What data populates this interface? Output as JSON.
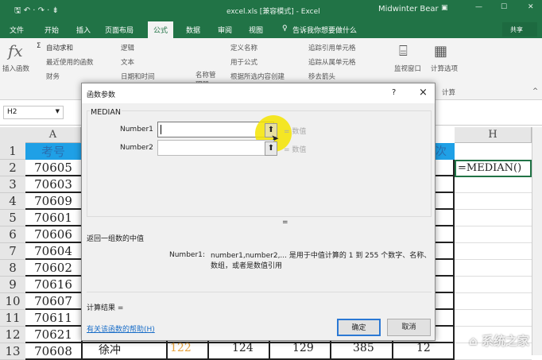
{
  "titlebar": {
    "title": "excel.xls [兼容模式] - Excel",
    "user": "Midwinter Bear"
  },
  "tabs": [
    "文件",
    "开始",
    "插入",
    "页面布局",
    "公式",
    "数据",
    "审阅",
    "视图"
  ],
  "tell_me": "告诉我你想要做什么",
  "share": "共享",
  "ribbon": {
    "insert_function": "插入函数",
    "autosum": "自动求和",
    "recent": "最近使用的函数",
    "financial": "财务",
    "logical": "逻辑",
    "text": "文本",
    "datetime": "日期和时间",
    "name_manager": "名称管理器",
    "define_name": "定义名称",
    "use_in_formula": "用于公式",
    "create_from_selection": "根据所选内容创建",
    "trace_precedents": "追踪引用单元格",
    "trace_dependents": "追踪从属单元格",
    "remove_arrows": "移去箭头",
    "watch_window": "监视窗口",
    "calc_options": "计算选项",
    "calc_group": "计算"
  },
  "namebox": "H2",
  "columns": [
    "A",
    "H"
  ],
  "header_row": {
    "a1": "考号",
    "g1": "次"
  },
  "rows": [
    "1",
    "2",
    "3",
    "4",
    "5",
    "6",
    "7",
    "8",
    "9",
    "10",
    "11",
    "12",
    "13"
  ],
  "col_a": [
    "70605",
    "70603",
    "70609",
    "70601",
    "70606",
    "70604",
    "70602",
    "70616",
    "70607",
    "70611",
    "70621",
    "70608"
  ],
  "row13": [
    "徐冲",
    "122",
    "124",
    "129",
    "385",
    "12"
  ],
  "h2": "=MEDIAN()",
  "dialog": {
    "title": "函数参数",
    "help": "?",
    "close": "×",
    "function": "MEDIAN",
    "arg1_label": "Number1",
    "arg2_label": "Number2",
    "arg_hint": "= 数值",
    "result_eq": "=",
    "description": "返回一组数的中值",
    "arg_desc_label": "Number1:",
    "arg_desc": "number1,number2,... 是用于中值计算的 1 到 255 个数字、名称、数组，或者是数值引用",
    "calc_result": "计算结果 =",
    "help_link": "有关该函数的帮助(H)",
    "ok": "确定",
    "cancel": "取消"
  },
  "watermark": "系统之家",
  "colors": {
    "excel_green": "#217346",
    "header_blue": "#1fa0e6",
    "highlight": "#f5e400"
  }
}
